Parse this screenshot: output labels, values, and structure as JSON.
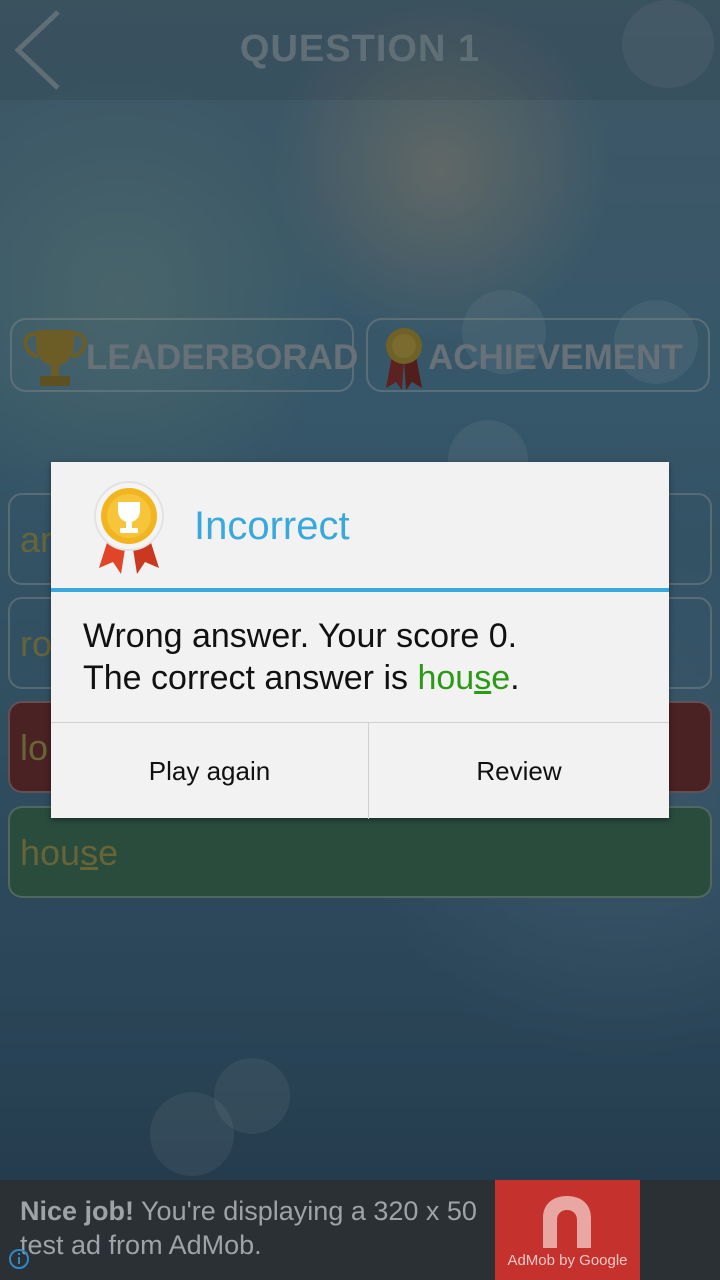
{
  "header": {
    "title": "QUESTION 1"
  },
  "buttons": {
    "leaderboard": "LEADERBORAD",
    "achievement": "ACHIEVEMENT"
  },
  "answers": [
    {
      "label": "ar",
      "state": "neutral"
    },
    {
      "label": "ro",
      "state": "neutral"
    },
    {
      "label": "lo",
      "state": "wrong"
    },
    {
      "label_pre": "hou",
      "label_u": "s",
      "label_post": "e",
      "state": "correct"
    }
  ],
  "dialog": {
    "title": "Incorrect",
    "line1": "Wrong answer. Your score 0.",
    "line2_prefix": "The correct answer is ",
    "answer_pre": "hou",
    "answer_u": "s",
    "answer_post": "e",
    "line2_suffix": ".",
    "play_again": "Play again",
    "review": "Review"
  },
  "ad": {
    "bold": "Nice job!",
    "text": " You're displaying a 320 x 50 test ad from AdMob.",
    "logo_caption": "AdMob by Google"
  },
  "colors": {
    "accent": "#39a8dc",
    "correct": "#2b9a14",
    "wrong_bg": "#7a2b2b",
    "correct_bg": "#3f7a58"
  }
}
